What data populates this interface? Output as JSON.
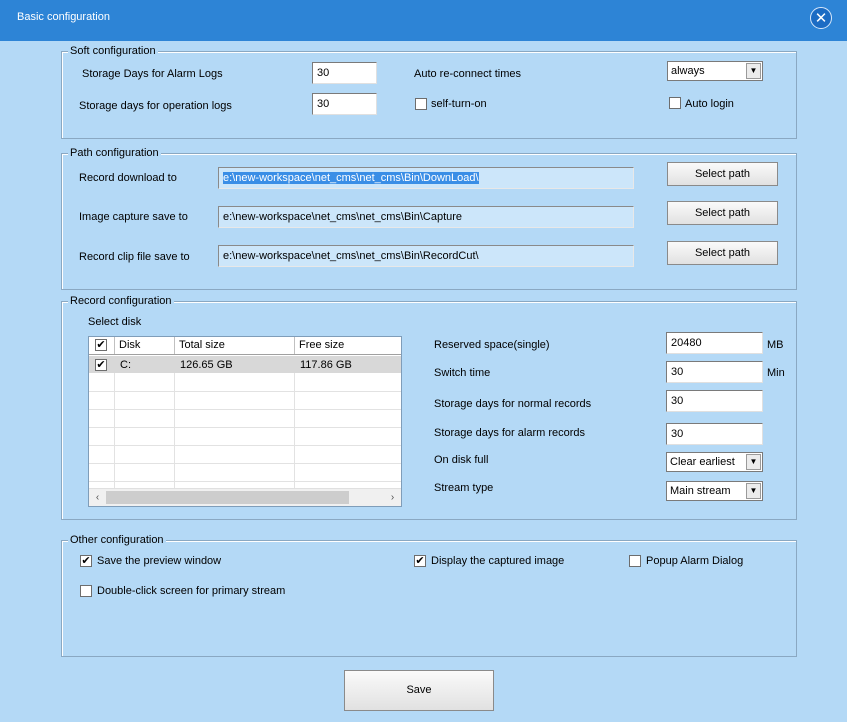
{
  "window": {
    "title": "Basic configuration",
    "close_icon": "close-icon"
  },
  "soft": {
    "legend": "Soft configuration",
    "alarm_logs_label": "Storage Days for Alarm Logs",
    "alarm_logs_value": "30",
    "operation_logs_label": "Storage days for operation logs",
    "operation_logs_value": "30",
    "reconnect_label": "Auto re-connect times",
    "reconnect_value": "always",
    "self_turn_on_label": "self-turn-on",
    "self_turn_on_checked": false,
    "auto_login_label": "Auto login",
    "auto_login_checked": false
  },
  "path": {
    "legend": "Path configuration",
    "rows": [
      {
        "label": "Record download to",
        "value": "e:\\new-workspace\\net_cms\\net_cms\\Bin\\DownLoad\\",
        "button": "Select path"
      },
      {
        "label": "Image capture save to",
        "value": "e:\\new-workspace\\net_cms\\net_cms\\Bin\\Capture",
        "button": "Select path"
      },
      {
        "label": "Record clip file save to",
        "value": "e:\\new-workspace\\net_cms\\net_cms\\Bin\\RecordCut\\",
        "button": "Select path"
      }
    ]
  },
  "record": {
    "legend": "Record configuration",
    "select_disk_label": "Select disk",
    "columns": [
      "Disk",
      "Total size",
      "Free size"
    ],
    "disks": [
      {
        "checked": true,
        "disk": "C:",
        "total": "126.65 GB",
        "free": "117.86 GB"
      }
    ],
    "reserved_label": "Reserved space(single)",
    "reserved_value": "20480",
    "reserved_unit": "MB",
    "switch_label": "Switch time",
    "switch_value": "30",
    "switch_unit": "Min",
    "normal_days_label": "Storage days for normal records",
    "normal_days_value": "30",
    "alarm_days_label": "Storage days for alarm records",
    "alarm_days_value": "30",
    "disk_full_label": "On disk full",
    "disk_full_value": "Clear earliest",
    "stream_label": "Stream type",
    "stream_value": "Main stream"
  },
  "other": {
    "legend": "Other configuration",
    "save_preview_label": "Save the preview window",
    "save_preview_checked": true,
    "display_captured_label": "Display the captured image",
    "display_captured_checked": true,
    "popup_alarm_label": "Popup Alarm Dialog",
    "popup_alarm_checked": false,
    "double_click_label": "Double-click screen for primary stream",
    "double_click_checked": false
  },
  "footer": {
    "save_label": "Save"
  },
  "chrome": {
    "check_glyph": "✔",
    "dropdown_glyph": "▼",
    "left_glyph": "‹",
    "right_glyph": "›",
    "close_glyph": "✕"
  }
}
